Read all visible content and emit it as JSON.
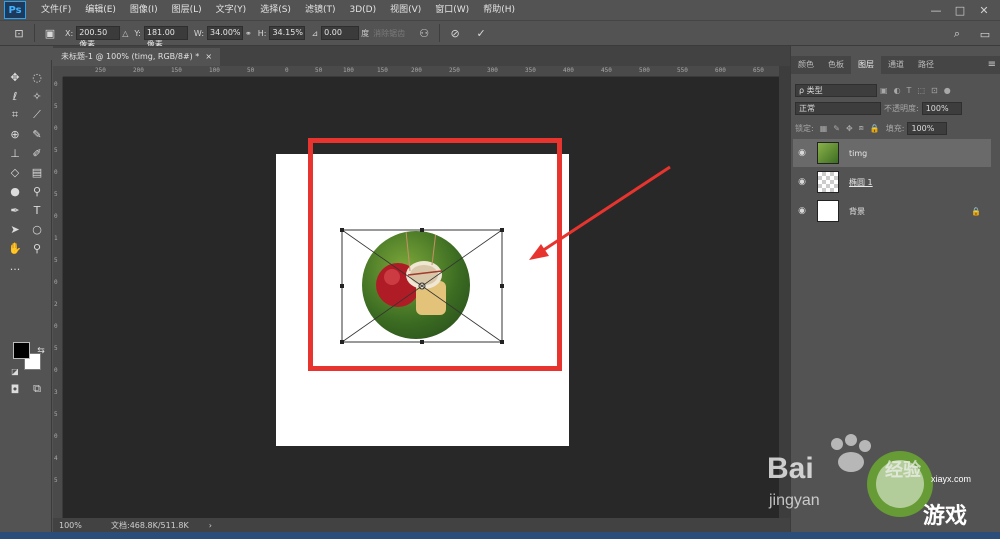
{
  "app": {
    "logo": "Ps"
  },
  "menu": [
    "文件(F)",
    "编辑(E)",
    "图像(I)",
    "图层(L)",
    "文字(Y)",
    "选择(S)",
    "滤镜(T)",
    "3D(D)",
    "视图(V)",
    "窗口(W)",
    "帮助(H)"
  ],
  "window_controls": [
    "—",
    "□",
    "✕"
  ],
  "options": {
    "x_label": "X:",
    "x_value": "200.50 像素",
    "y_label": "Y:",
    "y_value": "181.00 像素",
    "w_label": "W:",
    "w_value": "34.00%",
    "h_label": "H:",
    "h_value": "34.15%",
    "angle_value": "0.00",
    "angle_unit": "度",
    "interp_label": "消除锯齿"
  },
  "document": {
    "tab_title": "未标题-1 @ 100% (timg, RGB/8#) *",
    "close": "×"
  },
  "ruler_top": [
    "250",
    "200",
    "150",
    "100",
    "50",
    "0",
    "50",
    "100",
    "150",
    "200",
    "250",
    "300",
    "350",
    "400",
    "450",
    "500",
    "550",
    "600",
    "650"
  ],
  "ruler_left": [
    "0",
    "5",
    "0",
    "5",
    "0",
    "5",
    "0",
    "1",
    "5",
    "0",
    "2",
    "0",
    "5",
    "0",
    "3",
    "5",
    "0",
    "4",
    "5"
  ],
  "status": {
    "zoom": "100%",
    "doc_info": "文档:468.8K/511.8K",
    "arrow": "›"
  },
  "panels": {
    "tabs": [
      "颜色",
      "色板",
      "图层",
      "通道",
      "路径"
    ],
    "active_tab": "图层",
    "filter_label": "ρ 类型",
    "blend_mode": "正常",
    "opacity_label": "不透明度:",
    "opacity_value": "100%",
    "lock_label": "锁定:",
    "fill_label": "填充:",
    "fill_value": "100%",
    "layers": [
      {
        "name": "timg",
        "selected": true,
        "locked": false
      },
      {
        "name": "椭圆 1",
        "selected": false,
        "locked": false
      },
      {
        "name": "背景",
        "selected": false,
        "locked": true
      }
    ]
  },
  "watermark": {
    "brand": "Bai",
    "brand_suffix": "经验",
    "url": "jingyan",
    "site": "xiayx.com",
    "site_cn": "游戏"
  },
  "colors": {
    "accent_red": "#e8342f",
    "canvas": "#ffffff",
    "workspace": "#282828"
  }
}
